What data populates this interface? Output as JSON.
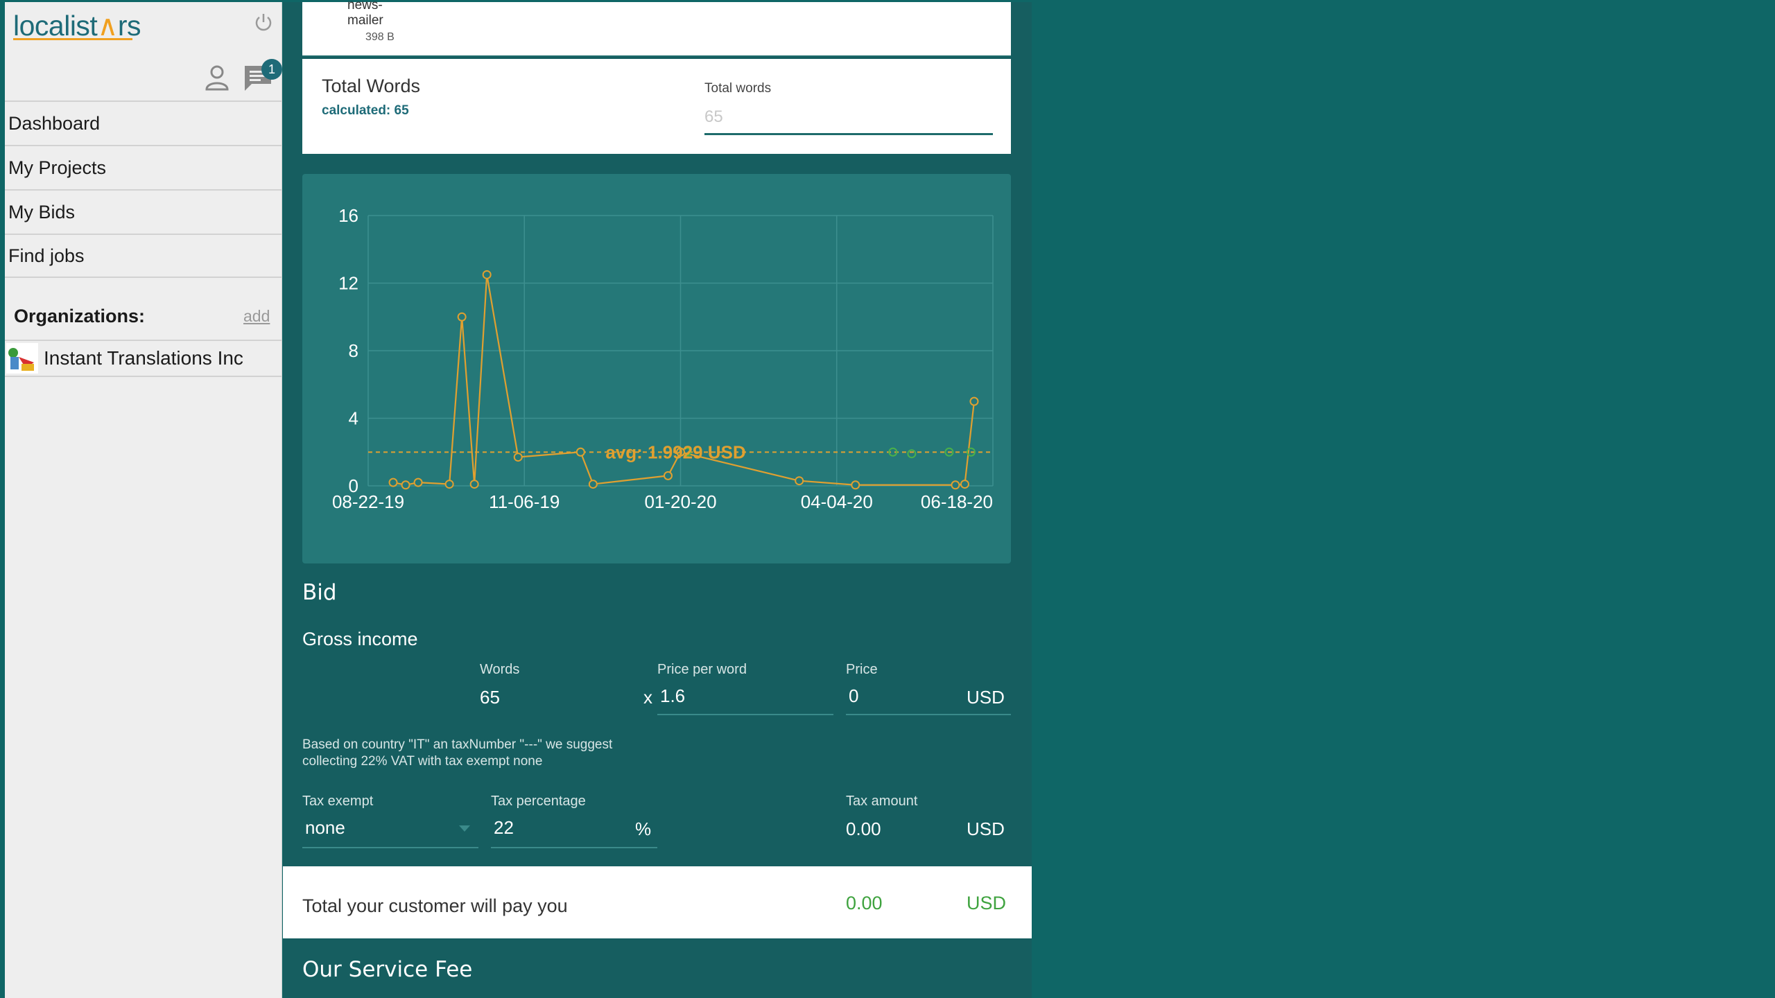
{
  "brand": {
    "logo_part1": "localist",
    "logo_accent": "∧",
    "logo_part2": "rs"
  },
  "header": {
    "notification_count": "1"
  },
  "nav": [
    {
      "label": "Dashboard"
    },
    {
      "label": "My Projects"
    },
    {
      "label": "My Bids"
    },
    {
      "label": "Find jobs"
    }
  ],
  "organizations": {
    "heading": "Organizations:",
    "add_label": "add",
    "items": [
      {
        "name": "Instant Translations Inc"
      }
    ]
  },
  "file": {
    "name_line1": "news-",
    "name_line2": "mailer",
    "size": "398 B"
  },
  "total_words": {
    "title": "Total Words",
    "calculated": "calculated: 65",
    "field_label": "Total words",
    "placeholder": "65"
  },
  "chart_data": {
    "type": "line",
    "x_ticks": [
      "08-22-19",
      "11-06-19",
      "01-20-20",
      "04-04-20",
      "06-18-20"
    ],
    "y_ticks": [
      "0",
      "4",
      "8",
      "12",
      "16"
    ],
    "ylim": [
      0,
      16
    ],
    "annotation": "avg: 1.9929 USD",
    "average": 1.9929,
    "series": [
      {
        "x": [
          0.04,
          0.06,
          0.08,
          0.13,
          0.15,
          0.17,
          0.19,
          0.24,
          0.34,
          0.36,
          0.48,
          0.5,
          0.69,
          0.78,
          0.94,
          0.955,
          0.97
        ],
        "values": [
          0.2,
          0.05,
          0.2,
          0.1,
          10.0,
          0.1,
          12.5,
          1.7,
          2.0,
          0.1,
          0.6,
          2.0,
          0.3,
          0.05,
          0.05,
          0.1,
          5.0
        ]
      }
    ],
    "secondary_points": {
      "x": [
        0.34,
        0.51,
        0.84,
        0.87,
        0.93,
        0.965
      ],
      "values": [
        2.0,
        2.0,
        2.0,
        1.9,
        2.0,
        2.0
      ]
    }
  },
  "bid": {
    "title": "Bid",
    "gross_title": "Gross income",
    "words_label": "Words",
    "words_value": "65",
    "multiply": "x",
    "ppw_label": "Price per word",
    "ppw_value": "1.6",
    "price_label": "Price",
    "price_value": "0",
    "currency": "USD",
    "note_line1": "Based on country \"IT\" an taxNumber \"---\" we suggest",
    "note_line2": "collecting 22% VAT with tax exempt none",
    "tax_exempt_label": "Tax exempt",
    "tax_exempt_value": "none",
    "tax_pct_label": "Tax percentage",
    "tax_pct_value": "22",
    "pct_sign": "%",
    "tax_amount_label": "Tax amount",
    "tax_amount_value": "0.00"
  },
  "total": {
    "label": "Total your customer will pay you",
    "value": "0.00",
    "currency": "USD"
  },
  "service_fee": {
    "title": "Our Service Fee"
  },
  "colors": {
    "bg": "#0f6666",
    "panel": "#165e60",
    "chart_bg": "#257878",
    "line": "#e0a030",
    "green": "#3fa33f"
  }
}
